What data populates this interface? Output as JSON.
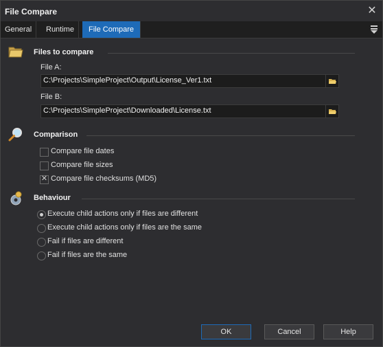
{
  "window": {
    "title": "File Compare",
    "close_glyph": "✕"
  },
  "tabs": [
    {
      "label": "General",
      "active": false
    },
    {
      "label": "Runtime",
      "active": false
    },
    {
      "label": "File Compare",
      "active": true
    }
  ],
  "sections": {
    "files": {
      "title": "Files to compare",
      "icon": "folder-icon",
      "file_a_label": "File A:",
      "file_a_value": "C:\\Projects\\SimpleProject\\Output\\License_Ver1.txt",
      "file_b_label": "File B:",
      "file_b_value": "C:\\Projects\\SimpleProject\\Downloaded\\License.txt"
    },
    "comparison": {
      "title": "Comparison",
      "icon": "magnifier-icon",
      "options": [
        {
          "label": "Compare file dates",
          "checked": false
        },
        {
          "label": "Compare file sizes",
          "checked": false
        },
        {
          "label": "Compare file checksums (MD5)",
          "checked": true
        }
      ]
    },
    "behaviour": {
      "title": "Behaviour",
      "icon": "gear-icon",
      "options": [
        {
          "label": "Execute child actions only if files are different",
          "selected": true
        },
        {
          "label": "Execute child actions only if files are the same",
          "selected": false
        },
        {
          "label": "Fail if files are different",
          "selected": false
        },
        {
          "label": "Fail if files are the same",
          "selected": false
        }
      ]
    }
  },
  "buttons": {
    "ok": "OK",
    "cancel": "Cancel",
    "help": "Help"
  },
  "colors": {
    "accent": "#1e6bb8",
    "background": "#2d2d30",
    "field_bg": "#1c1c1c"
  }
}
